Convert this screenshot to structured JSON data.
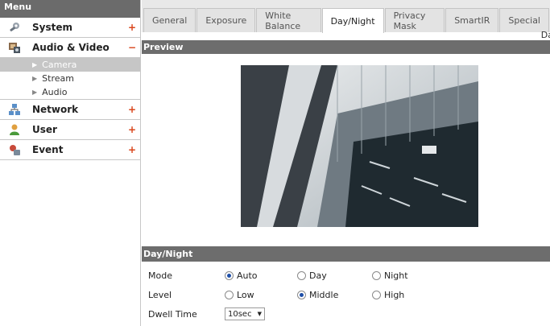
{
  "sidebar": {
    "header": "Menu",
    "categories": [
      {
        "label": "System",
        "sign": "+",
        "icon": "wrench-gear-icon"
      },
      {
        "label": "Audio & Video",
        "sign": "−",
        "icon": "media-icon"
      },
      {
        "label": "Network",
        "sign": "+",
        "icon": "network-icon"
      },
      {
        "label": "User",
        "sign": "+",
        "icon": "user-icon"
      },
      {
        "label": "Event",
        "sign": "+",
        "icon": "event-icon"
      }
    ],
    "sub_items": [
      {
        "label": "Camera",
        "active": true
      },
      {
        "label": "Stream",
        "active": false
      },
      {
        "label": "Audio",
        "active": false
      }
    ]
  },
  "tabs": [
    {
      "label": "General",
      "active": false
    },
    {
      "label": "Exposure",
      "active": false
    },
    {
      "label": "White Balance",
      "active": false
    },
    {
      "label": "Day/Night",
      "active": true
    },
    {
      "label": "Privacy Mask",
      "active": false
    },
    {
      "label": "SmartIR",
      "active": false
    },
    {
      "label": "Special",
      "active": false
    }
  ],
  "trail_text": "Da",
  "preview": {
    "title": "Preview"
  },
  "daynight": {
    "title": "Day/Night",
    "mode": {
      "label": "Mode",
      "options": [
        "Auto",
        "Day",
        "Night"
      ],
      "selected": "Auto"
    },
    "level": {
      "label": "Level",
      "options": [
        "Low",
        "Middle",
        "High"
      ],
      "selected": "Middle"
    },
    "dwell": {
      "label": "Dwell Time",
      "value": "10sec"
    }
  },
  "colors": {
    "section_bar": "#6d6d6d",
    "accent_sign": "#d9441a",
    "radio_dot": "#1e4fa8"
  }
}
